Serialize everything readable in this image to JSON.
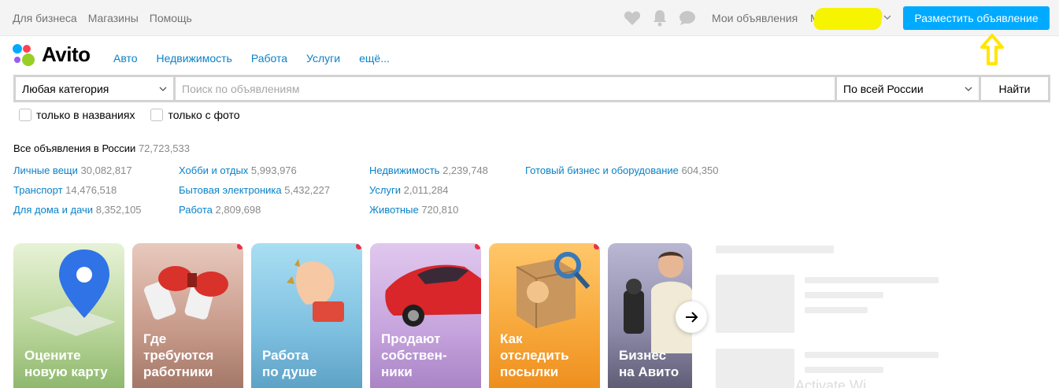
{
  "topbar": {
    "links": [
      "Для бизнеса",
      "Магазины",
      "Помощь"
    ],
    "icons": [
      "heart-icon",
      "bell-icon",
      "chat-icon"
    ],
    "my_ads": "Мои объявления",
    "user_initial": "М",
    "post_button": "Разместить объявление"
  },
  "logo": {
    "text": "Avito"
  },
  "nav": [
    "Авто",
    "Недвижимость",
    "Работа",
    "Услуги",
    "ещё..."
  ],
  "search": {
    "category": "Любая категория",
    "placeholder": "Поиск по объявлениям",
    "region": "По всей России",
    "find_button": "Найти"
  },
  "filters": [
    "только в названиях",
    "только с фото"
  ],
  "all_ads": {
    "label": "Все объявления в России",
    "count": "72,723,533"
  },
  "categories": [
    {
      "name": "Личные вещи",
      "count": "30,082,817"
    },
    {
      "name": "Транспорт",
      "count": "14,476,518"
    },
    {
      "name": "Для дома и дачи",
      "count": "8,352,105"
    },
    {
      "name": "Хобби и отдых",
      "count": "5,993,976"
    },
    {
      "name": "Бытовая электроника",
      "count": "5,432,227"
    },
    {
      "name": "Работа",
      "count": "2,809,698"
    },
    {
      "name": "Недвижимость",
      "count": "2,239,748"
    },
    {
      "name": "Услуги",
      "count": "2,011,284"
    },
    {
      "name": "Животные",
      "count": "720,810"
    },
    {
      "name": "Готовый бизнес и оборудование",
      "count": "604,350"
    }
  ],
  "stories": [
    {
      "caption": "Оцените\nновую карту"
    },
    {
      "caption": "Где\nтребуются\nработники"
    },
    {
      "caption": "Работа\nпо душе"
    },
    {
      "caption": "Продают\nсобствен-\nники"
    },
    {
      "caption": "Как\nотследить\nпосылки"
    },
    {
      "caption": "Бизнес\nна Авито"
    }
  ],
  "watermark": "Activate Wi",
  "colors": {
    "accent": "#00aaff",
    "link": "#0a82c8",
    "annotation": "#ffe600",
    "unread_dot": "#e6334b"
  }
}
